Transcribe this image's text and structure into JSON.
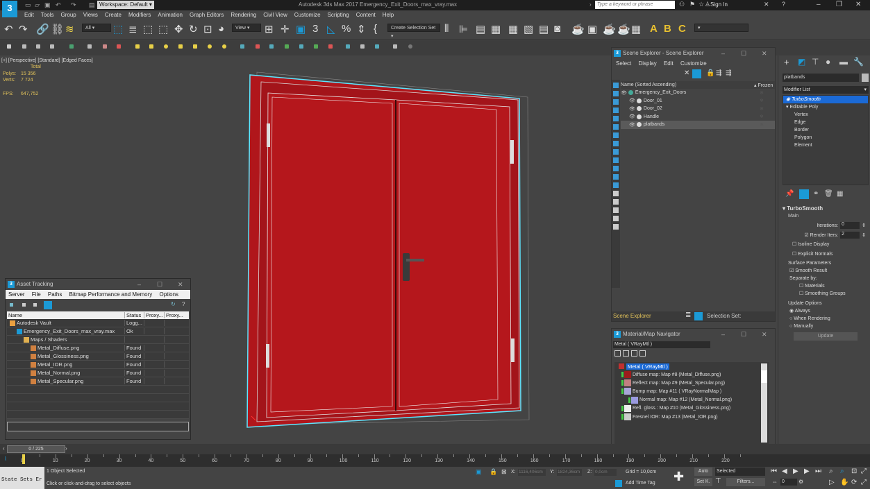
{
  "app": {
    "logo": "3",
    "window_title": "Autodesk 3ds Max 2017    Emergency_Exit_Doors_max_vray.max",
    "workspace_label": "Workspace: Default",
    "search_placeholder": "Type a keyword or phrase",
    "sign_in": "Sign In"
  },
  "menu": [
    "Edit",
    "Tools",
    "Group",
    "Views",
    "Create",
    "Modifiers",
    "Animation",
    "Graph Editors",
    "Rendering",
    "Civil View",
    "Customize",
    "Scripting",
    "Content",
    "Help"
  ],
  "toolbar": {
    "filter_select": "All",
    "view_select": "View",
    "selection_set": "Create Selection Set"
  },
  "viewport": {
    "label": "[+] [Perspective] [Standard] [Edged Faces]",
    "stats_header": "Total",
    "polys_label": "Polys:",
    "polys_value": "15 356",
    "verts_label": "Verts:",
    "verts_value": "7 724",
    "fps_label": "FPS:",
    "fps_value": "647,752",
    "door_color": "#b0161b"
  },
  "scene_explorer": {
    "title": "Scene Explorer - Scene Explorer",
    "menu": [
      "Select",
      "Display",
      "Edit",
      "Customize"
    ],
    "col_name": "Name (Sorted Ascending)",
    "col_frozen": "▴ Frozen",
    "items": [
      {
        "name": "Emergency_Exit_Doors",
        "level": 0,
        "selected": false
      },
      {
        "name": "Door_01",
        "level": 1,
        "selected": false
      },
      {
        "name": "Door_02",
        "level": 1,
        "selected": false
      },
      {
        "name": "Handle",
        "level": 1,
        "selected": false
      },
      {
        "name": "platbands",
        "level": 1,
        "selected": true
      }
    ],
    "footer_label": "Scene Explorer",
    "selection_set_label": "Selection Set:"
  },
  "command_panel": {
    "object_name": "platbands",
    "modifier_list_label": "Modifier List",
    "stack": [
      {
        "name": "TurboSmooth",
        "selected": true,
        "italic": true
      },
      {
        "name": "Editable Poly",
        "selected": false,
        "italic": false
      },
      {
        "name": "Vertex",
        "selected": false,
        "indent": true
      },
      {
        "name": "Edge",
        "selected": false,
        "indent": true
      },
      {
        "name": "Border",
        "selected": false,
        "indent": true
      },
      {
        "name": "Polygon",
        "selected": false,
        "indent": true
      },
      {
        "name": "Element",
        "selected": false,
        "indent": true
      }
    ],
    "rollout_title": "TurboSmooth",
    "main_label": "Main",
    "iterations_label": "Iterations:",
    "iterations_value": "0",
    "render_iters_label": "Render Iters:",
    "render_iters_value": "2",
    "isoline_label": "Isoline Display",
    "explicit_normals_label": "Explicit Normals",
    "surface_params_label": "Surface Parameters",
    "smooth_result_label": "Smooth Result",
    "separate_by_label": "Separate by:",
    "materials_label": "Materials",
    "smoothing_groups_label": "Smoothing Groups",
    "update_options_label": "Update Options",
    "always_label": "Always",
    "when_rendering_label": "When Rendering",
    "manually_label": "Manually",
    "update_button": "Update"
  },
  "asset_tracking": {
    "title": "Asset Tracking",
    "menu": [
      "Server",
      "File",
      "Paths",
      "Bitmap Performance and Memory",
      "Options"
    ],
    "columns": [
      "Name",
      "Status",
      "Proxy...",
      "Proxy..."
    ],
    "rows": [
      {
        "name": "Autodesk Vault",
        "status": "Logg...",
        "level": 0,
        "icon": "vault"
      },
      {
        "name": "Emergency_Exit_Doors_max_vray.max",
        "status": "Ok",
        "level": 1,
        "icon": "max"
      },
      {
        "name": "Maps / Shaders",
        "status": "",
        "level": 2,
        "icon": "folder"
      },
      {
        "name": "Metal_Diffuse.png",
        "status": "Found",
        "level": 3,
        "icon": "image"
      },
      {
        "name": "Metal_Glossiness.png",
        "status": "Found",
        "level": 3,
        "icon": "image"
      },
      {
        "name": "Metal_IOR.png",
        "status": "Found",
        "level": 3,
        "icon": "image"
      },
      {
        "name": "Metal_Normal.png",
        "status": "Found",
        "level": 3,
        "icon": "image"
      },
      {
        "name": "Metal_Specular.png",
        "status": "Found",
        "level": 3,
        "icon": "image"
      }
    ]
  },
  "material_navigator": {
    "title": "Material/Map Navigator",
    "current": "Metal  ( VRayMtl )",
    "root": "Metal  ( VRayMtl )",
    "items": [
      {
        "label": "Diffuse map: Map #8 (Metal_Diffuse.png)",
        "swatch": "#9b1c1c"
      },
      {
        "label": "Reflect map: Map #9 (Metal_Specular.png)",
        "swatch": "#c08080"
      },
      {
        "label": "Bump map: Map #11  ( VRayNormalMap )",
        "swatch": "#a9a6d8"
      },
      {
        "label": "Normal map: Map #12 (Metal_Normal.png)",
        "swatch": "#9a9ae0",
        "indent": true
      },
      {
        "label": "Refl. gloss.: Map #10 (Metal_Glossiness.png)",
        "swatch": "#eeeeee"
      },
      {
        "label": "Fresnel IOR: Map #13 (Metal_IOR.png)",
        "swatch": "#cccccc"
      }
    ]
  },
  "timeline": {
    "frame_label": "0 / 225",
    "progress": 0,
    "ticks": [
      "0",
      "10",
      "20",
      "30",
      "40",
      "50",
      "60",
      "70",
      "80",
      "90",
      "100",
      "110",
      "120",
      "130",
      "140",
      "150",
      "160",
      "170",
      "180",
      "190",
      "200",
      "210",
      "220"
    ]
  },
  "status": {
    "maxscript": "State Sets Er",
    "objects_selected": "1 Object Selected",
    "prompt": "Click or click-and-drag to select objects",
    "x_label": "X:",
    "x_value": "1116,406cm",
    "y_label": "Y:",
    "y_value": "1824,36cm",
    "z_label": "Z:",
    "z_value": "0,0cm",
    "grid": "Grid = 10,0cm",
    "add_time_tag": "Add Time Tag",
    "auto_key": "Auto",
    "set_key": "Set K.",
    "selected_dropdown": "Selected",
    "filters": "Filters...",
    "current_frame": "0"
  }
}
